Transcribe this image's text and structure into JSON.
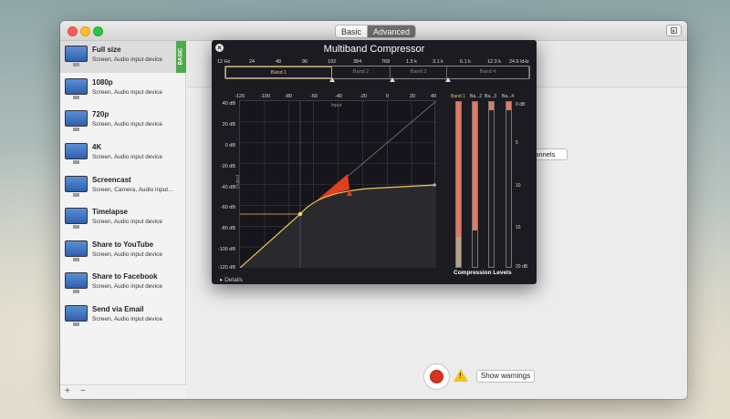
{
  "window": {
    "mode_tabs": [
      "Basic",
      "Advanced"
    ],
    "active_mode": "Advanced"
  },
  "sidebar": {
    "badge": "BASIC",
    "presets": [
      {
        "name": "Full size",
        "desc": "Screen, Audio input device"
      },
      {
        "name": "1080p",
        "desc": "Screen, Audio input device"
      },
      {
        "name": "720p",
        "desc": "Screen, Audio input device"
      },
      {
        "name": "4K",
        "desc": "Screen, Audio input device"
      },
      {
        "name": "Screencast",
        "desc": "Screen, Camera, Audio input..."
      },
      {
        "name": "Timelapse",
        "desc": "Screen, Audio input device"
      },
      {
        "name": "Share to YouTube",
        "desc": "Screen, Audio input device"
      },
      {
        "name": "Share to Facebook",
        "desc": "Screen, Audio input device"
      },
      {
        "name": "Send via Email",
        "desc": "Screen, Audio input device"
      }
    ],
    "add_label": "+",
    "remove_label": "−"
  },
  "main": {
    "channels_label": "hannels",
    "warnings_label": "Show warnings",
    "warning_glyph": "!"
  },
  "compressor": {
    "title": "Multiband Compressor",
    "frequencies": [
      "12 Hz",
      "24",
      "48",
      "96",
      "192",
      "384",
      "768",
      "1.5 k",
      "3.1 k",
      "6.1 k",
      "12.3 k",
      "24.6 kHz"
    ],
    "bands": [
      "Band 1",
      "Band 2",
      "Band 3",
      "Band 4"
    ],
    "active_band": "Band 1",
    "input_ticks": [
      "-120",
      "-100",
      "-80",
      "-60",
      "-40",
      "-20",
      "0",
      "20",
      "40"
    ],
    "output_ticks": [
      "40 dB",
      "20 dB",
      "0 dB",
      "-20 dB",
      "-40 dB",
      "-60 dB",
      "-80 dB",
      "-100 dB",
      "-120 dB"
    ],
    "input_label": "Input",
    "output_label": "Output",
    "details_label": "Details",
    "meter_labels": [
      "Band 1",
      "Ba...2",
      "Ba...3",
      "Ba...4"
    ],
    "meter_levels": [
      0.82,
      0.78,
      0.05,
      0.05
    ],
    "db_ticks": [
      "0 dB",
      "5",
      "10",
      "15",
      "20 dB"
    ],
    "compression_levels_label": "Compression Levels",
    "colors": {
      "curve": "#f5c65a",
      "reduction": "#e0401c",
      "meter": "#e27a66"
    }
  }
}
